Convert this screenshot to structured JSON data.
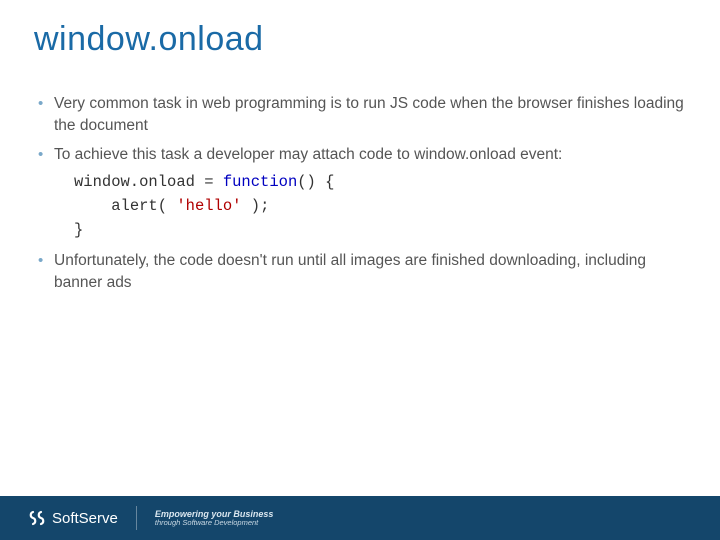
{
  "title": "window.onload",
  "bullets": {
    "b1": "Very common task in web programming is to run JS code when the browser finishes loading the document",
    "b2": "To achieve this task a developer may attach code to window.onload event:",
    "b3": "Unfortunately, the code doesn't run until all images are finished downloading, including banner ads"
  },
  "code": {
    "line1_a": "window.onload = ",
    "line1_kw": "function",
    "line1_b": "() {",
    "line2_a": "alert( ",
    "line2_str": "'hello'",
    "line2_b": " );",
    "line3": "}"
  },
  "footer": {
    "brand": "SoftServe",
    "tagline1": "Empowering your Business",
    "tagline2": "through Software Development"
  }
}
